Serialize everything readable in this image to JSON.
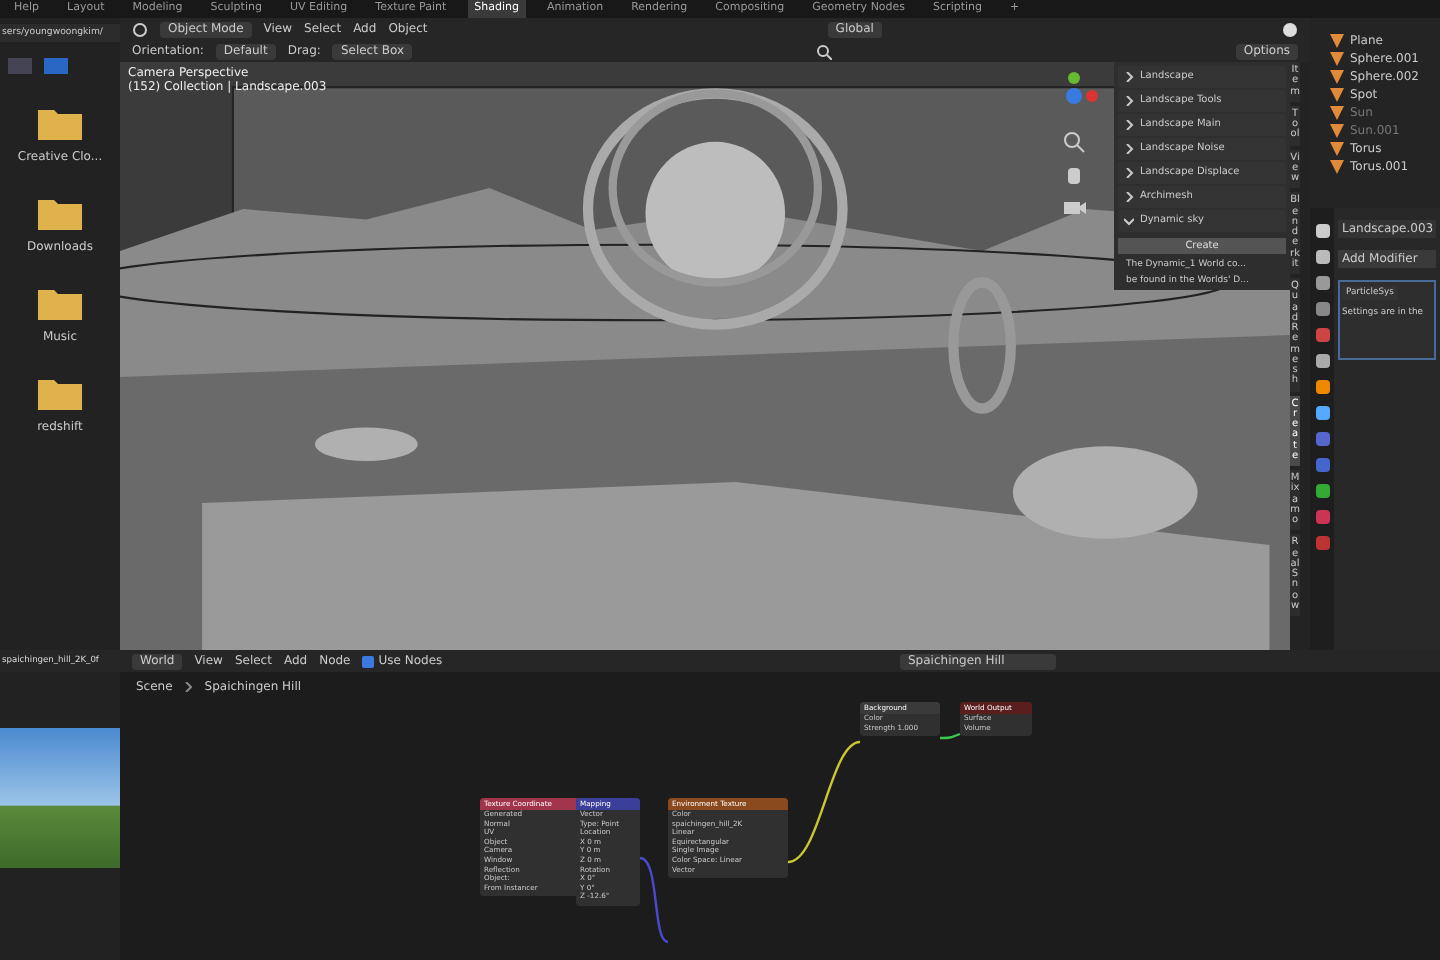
{
  "workspace_tabs": [
    {
      "label": "Help",
      "selected": false
    },
    {
      "label": "Layout",
      "selected": false
    },
    {
      "label": "Modeling",
      "selected": false
    },
    {
      "label": "Sculpting",
      "selected": false
    },
    {
      "label": "UV Editing",
      "selected": false
    },
    {
      "label": "Texture Paint",
      "selected": false
    },
    {
      "label": "Shading",
      "selected": true
    },
    {
      "label": "Animation",
      "selected": false
    },
    {
      "label": "Rendering",
      "selected": false
    },
    {
      "label": "Compositing",
      "selected": false
    },
    {
      "label": "Geometry Nodes",
      "selected": false
    },
    {
      "label": "Scripting",
      "selected": false
    },
    {
      "label": "+",
      "selected": false
    }
  ],
  "file_browser": {
    "path": "sers/youngwoongkim/",
    "folders": [
      {
        "name": "Creative Clo..."
      },
      {
        "name": "Downloads"
      },
      {
        "name": "Music"
      },
      {
        "name": "redshift"
      }
    ]
  },
  "viewport": {
    "mode": "Object Mode",
    "menus": [
      "View",
      "Select",
      "Add",
      "Object"
    ],
    "transform_orientation": "Global",
    "orientation_label": "Orientation:",
    "orientation_value": "Default",
    "drag_label": "Drag:",
    "drag_value": "Select Box",
    "options": "Options",
    "overlay_lines": [
      "Camera Perspective",
      "(152) Collection | Landscape.003"
    ],
    "panels": [
      {
        "label": "Landscape",
        "expanded": false
      },
      {
        "label": "Landscape Tools",
        "expanded": false
      },
      {
        "label": "Landscape Main",
        "expanded": false
      },
      {
        "label": "Landscape Noise",
        "expanded": false
      },
      {
        "label": "Landscape Displace",
        "expanded": false
      },
      {
        "label": "Archimesh",
        "expanded": false
      },
      {
        "label": "Dynamic sky",
        "expanded": true
      }
    ],
    "create_button": "Create",
    "info_lines": [
      "The Dynamic_1 World co...",
      "be found in the Worlds' D..."
    ],
    "side_tabs": [
      {
        "label": "Item",
        "selected": false
      },
      {
        "label": "Tool",
        "selected": false
      },
      {
        "label": "View",
        "selected": false
      },
      {
        "label": "Blenderkit",
        "selected": false
      },
      {
        "label": "Quad Remesh",
        "selected": false
      },
      {
        "label": "Create",
        "selected": true
      },
      {
        "label": "Mixamo",
        "selected": false
      },
      {
        "label": "Real Snow",
        "selected": false
      }
    ]
  },
  "outliner": {
    "items": [
      {
        "name": "Plane",
        "disabled": false
      },
      {
        "name": "Sphere.001",
        "disabled": false
      },
      {
        "name": "Sphere.002",
        "disabled": false
      },
      {
        "name": "Spot",
        "disabled": false
      },
      {
        "name": "Sun",
        "disabled": true
      },
      {
        "name": "Sun.001",
        "disabled": true
      },
      {
        "name": "Torus",
        "disabled": false
      },
      {
        "name": "Torus.001",
        "disabled": false
      }
    ]
  },
  "properties": {
    "object_name": "Landscape.003",
    "add_modifier": "Add Modifier",
    "modifier_name": "ParticleSys",
    "modifier_note": "Settings are in the"
  },
  "image_editor": {
    "image_name": "spaichingen_hill_2K_0f"
  },
  "node_editor": {
    "shader_type": "World",
    "menus": [
      "View",
      "Select",
      "Add",
      "Node"
    ],
    "use_nodes": {
      "label": "Use Nodes",
      "checked": true
    },
    "world_name": "Spaichingen Hill",
    "breadcrumbs": [
      "Scene",
      "Spaichingen Hill"
    ],
    "nodes": [
      {
        "title": "Texture Coordinate",
        "color": "#a1334a",
        "rows": [
          "Generated",
          "Normal",
          "UV",
          "Object",
          "Camera",
          "Window",
          "Reflection",
          "Object:",
          "From Instancer"
        ]
      },
      {
        "title": "Mapping",
        "color": "#3b3f9a",
        "rows": [
          "Vector",
          "Type: Point",
          "Location",
          "X 0 m",
          "Y 0 m",
          "Z 0 m",
          "Rotation",
          "X 0°",
          "Y 0°",
          "Z -12.6°"
        ]
      },
      {
        "title": "Environment Texture",
        "color": "#8a4a1e",
        "rows": [
          "Color",
          "spaichingen_hill_2K",
          "Linear",
          "Equirectangular",
          "Single Image",
          "Color Space: Linear",
          "Vector"
        ]
      },
      {
        "title": "Background",
        "color": "#3a3a3a",
        "rows": [
          "Color",
          "Strength 1.000"
        ]
      },
      {
        "title": "World Output",
        "color": "#5a1e1e",
        "rows": [
          "Surface",
          "Volume"
        ]
      }
    ]
  }
}
